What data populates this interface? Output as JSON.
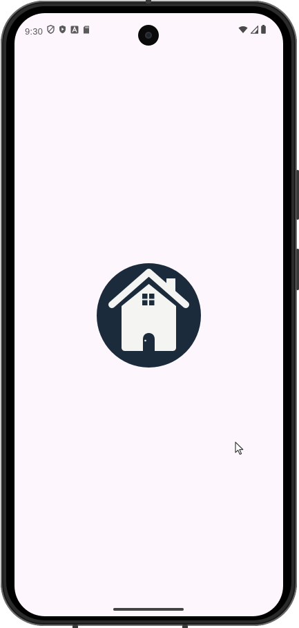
{
  "status_bar": {
    "time": "9:30",
    "left_icons": [
      "shield-outline-icon",
      "shield-play-icon",
      "font-a-icon",
      "sd-card-icon"
    ],
    "right_icons": [
      "wifi-icon",
      "cellular-signal-icon",
      "battery-icon"
    ]
  },
  "splash": {
    "logo": "house-logo-icon"
  },
  "colors": {
    "screen_background": "#fdf6fd",
    "logo_circle": "#1c2b3c",
    "logo_house": "#f4f5f2",
    "status_text": "#5a5a5a"
  }
}
